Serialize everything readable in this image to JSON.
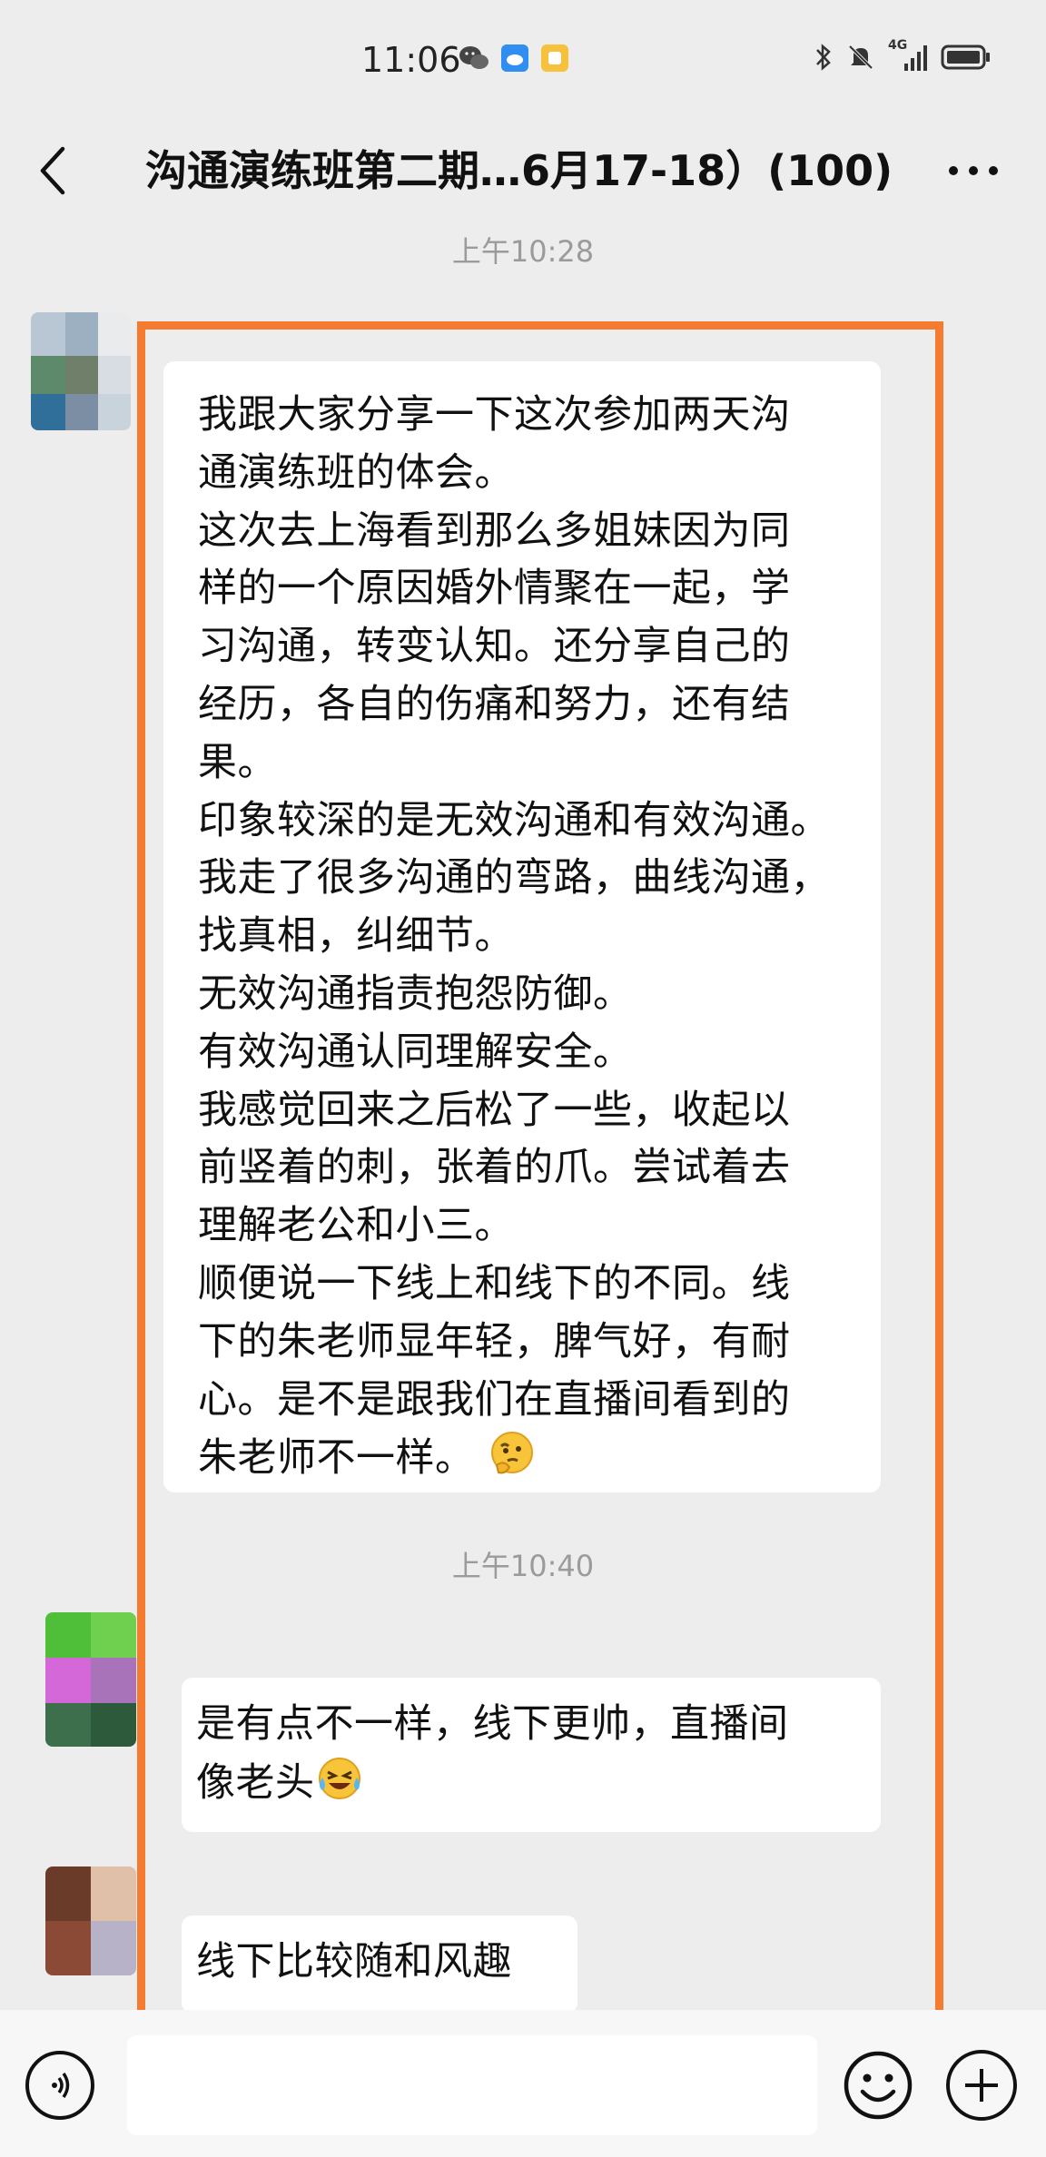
{
  "status_bar": {
    "time": "11:06",
    "network": "4G",
    "icons": [
      "wechat-icon",
      "app-notification-icon",
      "app-notification-icon",
      "bluetooth-icon",
      "mute-icon",
      "signal-icon",
      "battery-icon"
    ]
  },
  "header": {
    "title": "沟通演练班第二期…6月17-18）(100)",
    "back_icon": "chevron-left-icon",
    "more_icon": "more-dots-icon"
  },
  "messages": [
    {
      "timestamp": "上午10:28",
      "lines": [
        "我跟大家分享一下这次参加两天沟",
        "通演练班的体会。",
        "这次去上海看到那么多姐妹因为同",
        "样的一个原因婚外情聚在一起，学",
        "习沟通，转变认知。还分享自己的",
        "经历，各自的伤痛和努力，还有结",
        "果。",
        "印象较深的是无效沟通和有效沟通。",
        "我走了很多沟通的弯路，曲线沟通，",
        "找真相，纠细节。",
        "无效沟通指责抱怨防御。",
        "有效沟通认同理解安全。",
        "我感觉回来之后松了一些，收起以",
        "前竖着的刺，张着的爪。尝试着去",
        "理解老公和小三。",
        "顺便说一下线上和线下的不同。线",
        "下的朱老师显年轻，脾气好，有耐",
        "心。是不是跟我们在直播间看到的",
        "朱老师不一样。"
      ],
      "emoji": "thinking-face-emoji"
    },
    {
      "timestamp": "上午10:40",
      "lines": [
        "是有点不一样，线下更帅，直播间",
        "像老头"
      ],
      "emoji": "crying-laughing-emoji"
    },
    {
      "lines": [
        "线下比较随和风趣"
      ]
    }
  ],
  "input_bar": {
    "placeholder": "",
    "voice_icon": "voice-icon",
    "emoji_icon": "emoji-icon",
    "plus_icon": "plus-icon"
  },
  "colors": {
    "background": "#ededed",
    "bubble": "#ffffff",
    "highlight": "#f47b30",
    "timestamp": "#9b9b9b"
  }
}
